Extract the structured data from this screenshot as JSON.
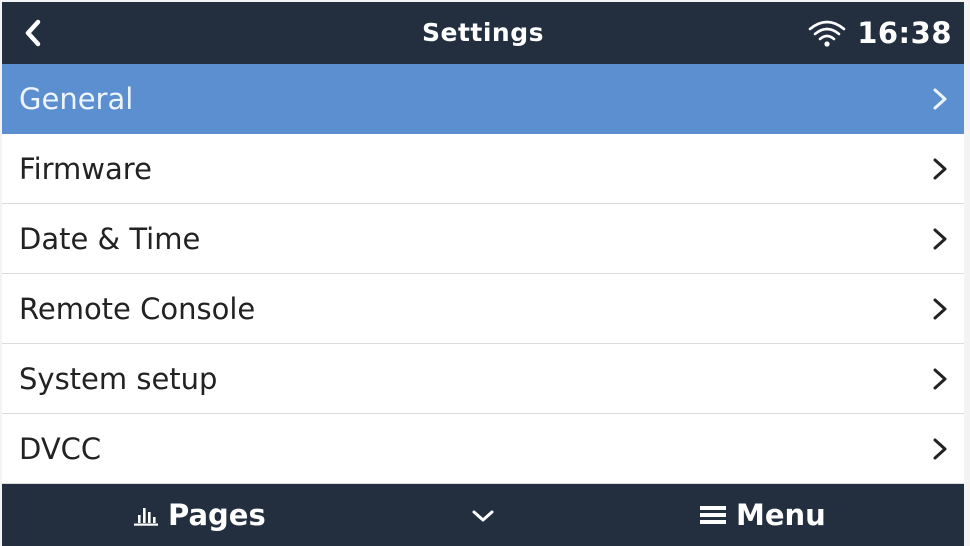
{
  "header": {
    "title": "Settings",
    "time": "16:38",
    "back_icon": "back-chevron-icon",
    "wifi_icon": "wifi-icon"
  },
  "menu_items": [
    {
      "label": "General",
      "selected": true
    },
    {
      "label": "Firmware",
      "selected": false
    },
    {
      "label": "Date & Time",
      "selected": false
    },
    {
      "label": "Remote Console",
      "selected": false
    },
    {
      "label": "System setup",
      "selected": false
    },
    {
      "label": "DVCC",
      "selected": false
    }
  ],
  "footer": {
    "pages_label": "Pages",
    "menu_label": "Menu",
    "pages_icon": "bar-chart-icon",
    "down_icon": "chevron-down-icon",
    "menu_icon": "hamburger-icon"
  },
  "colors": {
    "bar_background": "#232f3e",
    "selected_row": "#5b8fd0"
  }
}
